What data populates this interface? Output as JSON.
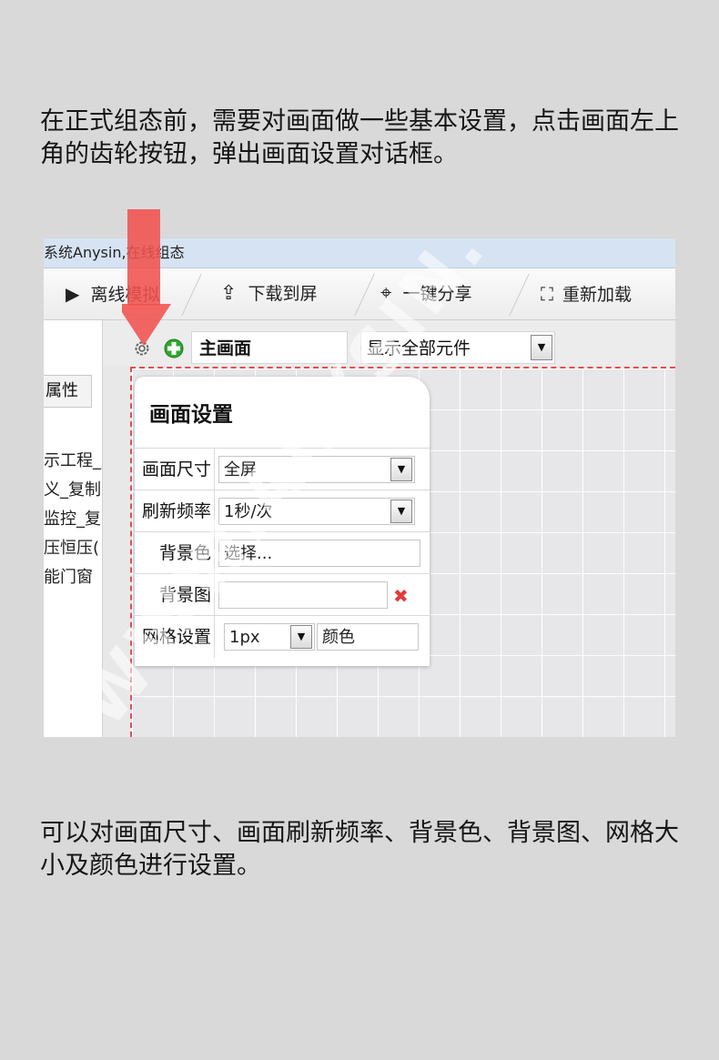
{
  "instructions": {
    "intro": "在正式组态前，需要对画面做一些基本设置，点击画面左上角的齿轮按钮，弹出画面设置对话框。",
    "summary": "可以对画面尺寸、画面刷新频率、背景色、背景图、网格大小及颜色进行设置。"
  },
  "window": {
    "title": "系统Anysin,在线组态"
  },
  "toolbar": {
    "offline_sim": "离线模拟",
    "download": "下载到屏",
    "share": "一键分享",
    "reload": "重新加载"
  },
  "left_panel": {
    "properties_tab": "属性",
    "items": [
      "示工程_复",
      "义_复制",
      "监控_复",
      "压恒压(",
      "能门窗"
    ]
  },
  "screen_bar": {
    "screen_name": "主画面",
    "display_mode": "显示全部元件"
  },
  "dialog": {
    "title": "画面设置",
    "rows": {
      "size": {
        "label": "画面尺寸",
        "value": "全屏"
      },
      "refresh": {
        "label": "刷新频率",
        "value": "1秒/次"
      },
      "bg_color": {
        "label": "背景色",
        "value": "选择..."
      },
      "bg_image": {
        "label": "背景图",
        "value": ""
      },
      "grid": {
        "label": "网格设置",
        "size": "1px",
        "color": "颜色"
      }
    }
  },
  "watermark": "WWW.ANYSIN.COM",
  "colors": {
    "arrow": "#f0524f",
    "canvas_border": "#e05050",
    "plus": "#2fa82f",
    "clear": "#e03a3a"
  }
}
